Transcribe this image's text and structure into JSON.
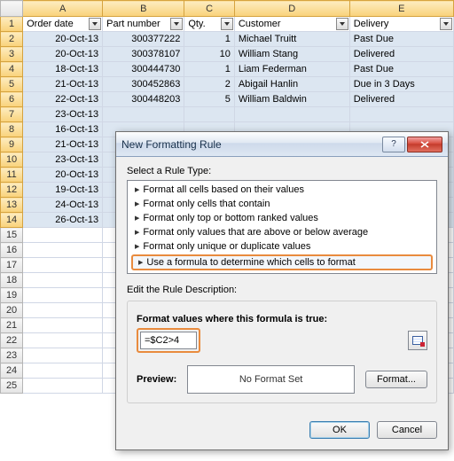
{
  "columns": [
    "A",
    "B",
    "C",
    "D",
    "E"
  ],
  "headers": [
    "Order date",
    "Part number",
    "Qty.",
    "Customer",
    "Delivery"
  ],
  "rows": [
    {
      "n": 1
    },
    {
      "n": 2,
      "date": "20-Oct-13",
      "part": "300377222",
      "qty": "1",
      "cust": "Michael Truitt",
      "deliv": "Past Due"
    },
    {
      "n": 3,
      "date": "20-Oct-13",
      "part": "300378107",
      "qty": "10",
      "cust": "William Stang",
      "deliv": "Delivered"
    },
    {
      "n": 4,
      "date": "18-Oct-13",
      "part": "300444730",
      "qty": "1",
      "cust": "Liam Federman",
      "deliv": "Past Due"
    },
    {
      "n": 5,
      "date": "21-Oct-13",
      "part": "300452863",
      "qty": "2",
      "cust": "Abigail Hanlin",
      "deliv": "Due in 3 Days"
    },
    {
      "n": 6,
      "date": "22-Oct-13",
      "part": "300448203",
      "qty": "5",
      "cust": "William Baldwin",
      "deliv": "Delivered"
    },
    {
      "n": 7,
      "date": "23-Oct-13"
    },
    {
      "n": 8,
      "date": "16-Oct-13"
    },
    {
      "n": 9,
      "date": "21-Oct-13"
    },
    {
      "n": 10,
      "date": "23-Oct-13"
    },
    {
      "n": 11,
      "date": "20-Oct-13"
    },
    {
      "n": 12,
      "date": "19-Oct-13"
    },
    {
      "n": 13,
      "date": "24-Oct-13"
    },
    {
      "n": 14,
      "date": "26-Oct-13"
    },
    {
      "n": 15
    },
    {
      "n": 16
    },
    {
      "n": 17
    },
    {
      "n": 18
    },
    {
      "n": 19
    },
    {
      "n": 20
    },
    {
      "n": 21
    },
    {
      "n": 22
    },
    {
      "n": 23
    },
    {
      "n": 24
    },
    {
      "n": 25
    }
  ],
  "dialog": {
    "title": "New Formatting Rule",
    "select_label": "Select a Rule Type:",
    "rule_types": [
      "Format all cells based on their values",
      "Format only cells that contain",
      "Format only top or bottom ranked values",
      "Format only values that are above or below average",
      "Format only unique or duplicate values",
      "Use a formula to determine which cells to format"
    ],
    "edit_label": "Edit the Rule Description:",
    "formula_label": "Format values where this formula is true:",
    "formula_value": "=$C2>4",
    "preview_label": "Preview:",
    "preview_text": "No Format Set",
    "format_btn": "Format...",
    "ok": "OK",
    "cancel": "Cancel",
    "help": "?"
  }
}
